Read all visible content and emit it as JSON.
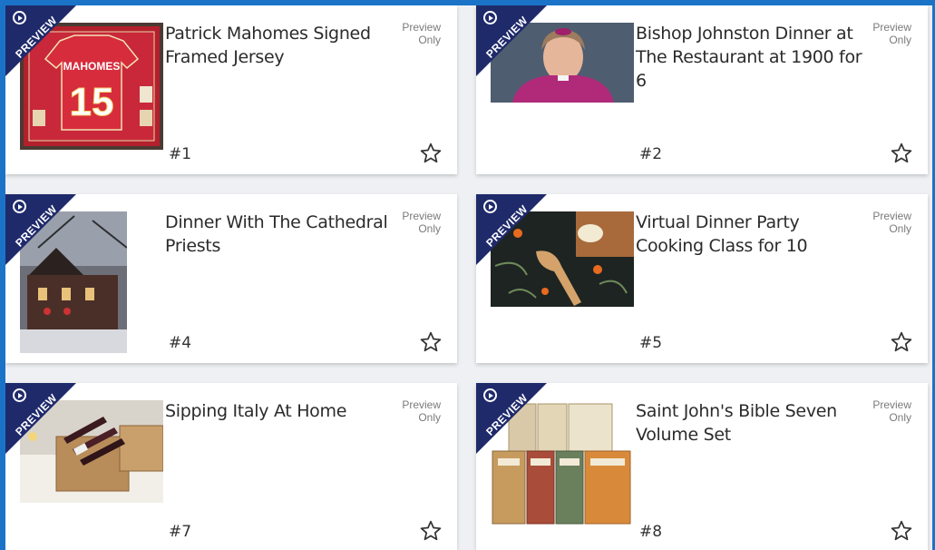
{
  "ribbon_label": "PREVIEW",
  "preview_line1": "Preview",
  "preview_line2": "Only",
  "items": [
    {
      "title": "Patrick Mahomes Signed Framed Jersey",
      "lot": "#1",
      "jersey_name": "MAHOMES",
      "jersey_number": "15"
    },
    {
      "title": "Bishop Johnston Dinner at The Restaurant at 1900 for 6",
      "lot": "#2"
    },
    {
      "title": "Dinner With The Cathedral Priests",
      "lot": "#4"
    },
    {
      "title": "Virtual Dinner Party Cooking Class for 10",
      "lot": "#5"
    },
    {
      "title": "Sipping Italy At Home",
      "lot": "#7"
    },
    {
      "title": "Saint John's Bible Seven Volume Set",
      "lot": "#8"
    }
  ]
}
